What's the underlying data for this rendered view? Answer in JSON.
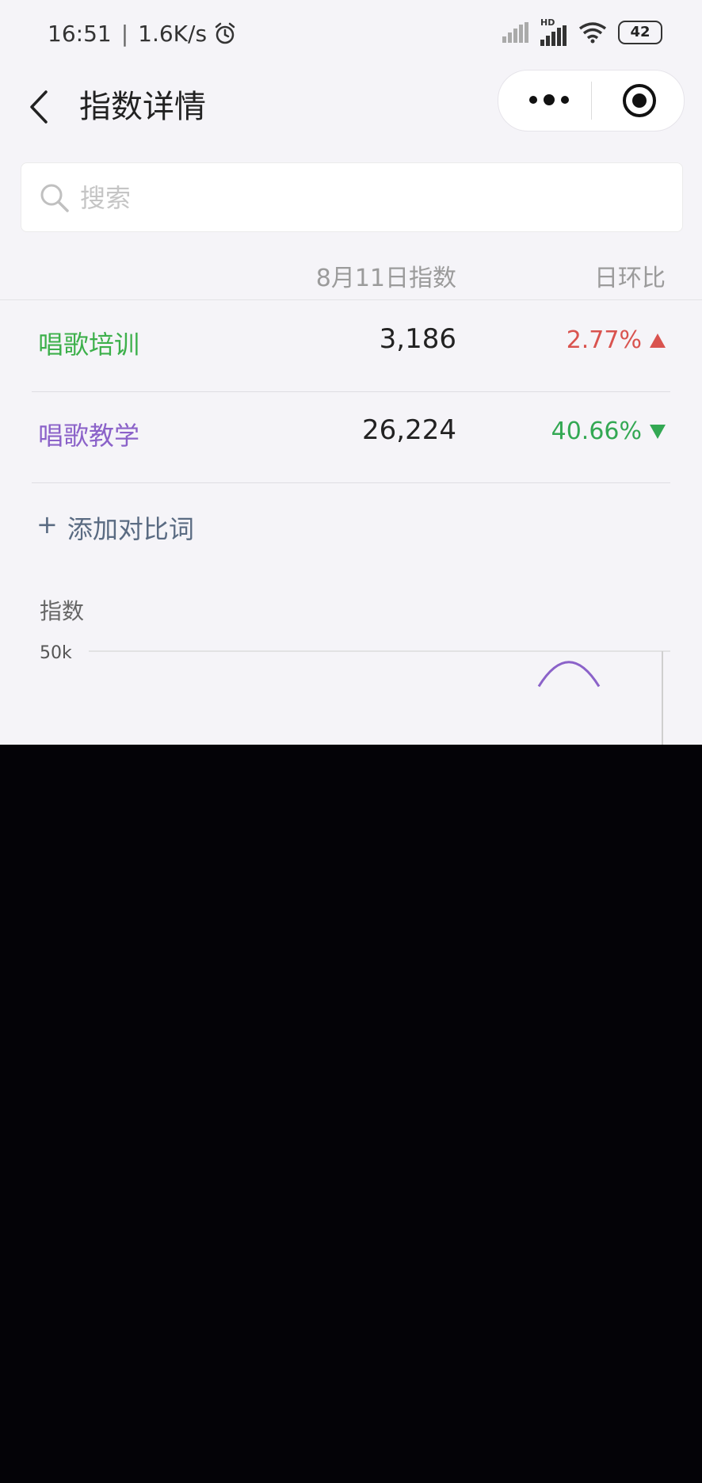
{
  "status_bar": {
    "time": "16:51",
    "speed": "1.6K/s",
    "battery": "42",
    "hd_label": "HD"
  },
  "nav": {
    "title": "指数详情"
  },
  "search": {
    "placeholder": "搜索"
  },
  "table": {
    "headers": {
      "date_index": "8月11日指数",
      "day_ratio": "日环比"
    },
    "rows": [
      {
        "keyword": "唱歌培训",
        "value": "3,186",
        "ratio": "2.77%",
        "direction": "up",
        "color": "#3db04b",
        "ratio_color": "#d9534f"
      },
      {
        "keyword": "唱歌教学",
        "value": "26,224",
        "ratio": "40.66%",
        "direction": "down",
        "color": "#8b62c9",
        "ratio_color": "#33a853"
      }
    ]
  },
  "add_compare": {
    "plus": "+",
    "label": "添加对比词"
  },
  "chart_data": {
    "type": "line",
    "ylabel": "指数",
    "y_tick_labels": [
      "50k"
    ],
    "ylim": [
      0,
      50000
    ],
    "series": [
      {
        "color": "#8b62c9",
        "points": [
          [
            0,
            38000
          ],
          [
            1,
            45000
          ],
          [
            2,
            38000
          ]
        ]
      }
    ]
  }
}
